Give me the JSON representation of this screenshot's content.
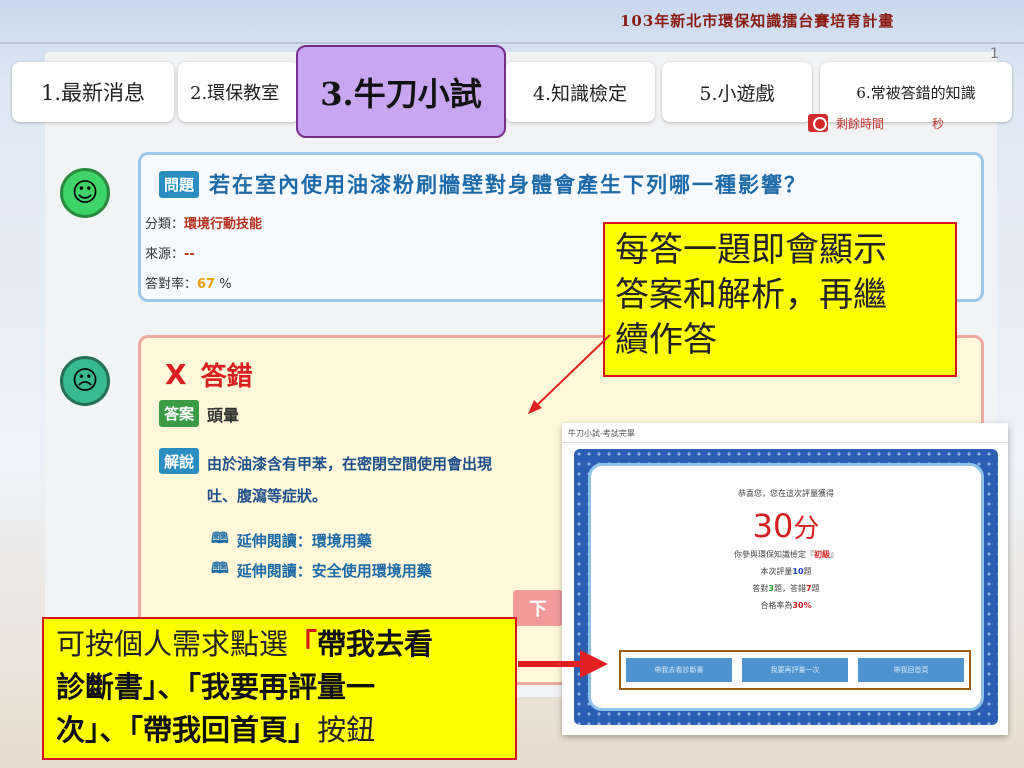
{
  "header": {
    "title": "103年新北市環保知識擂台賽培育計畫"
  },
  "page": {
    "number": "1"
  },
  "tabs": [
    {
      "label": "1.最新消息"
    },
    {
      "label": "2.環保教室"
    },
    {
      "label": "3.牛刀小試"
    },
    {
      "label": "4.知識檢定"
    },
    {
      "label": "5.小遊戲"
    },
    {
      "label": "6.常被答錯的知識"
    }
  ],
  "timer": {
    "label": "剩餘時間",
    "unit": "秒"
  },
  "question": {
    "badge": "問題",
    "text": "若在室內使用油漆粉刷牆壁對身體會產生下列哪一種影響？",
    "category_label": "分類：",
    "category_value": "環境行動技能",
    "source_label": "來源：",
    "source_value": "--",
    "rate_label": "答對率：",
    "rate_value": "67",
    "rate_unit": "%"
  },
  "answer": {
    "result_icon": "X",
    "result_text": "答錯",
    "answer_badge": "答案",
    "answer_value": "頭暈",
    "explain_badge": "解說",
    "explain_text": "由於油漆含有甲苯，在密閉空間使用會出現",
    "explain_text2": "吐、腹瀉等症狀。",
    "read_more_1": "延伸閱讀：環境用藥",
    "read_more_2": "延伸閱讀：安全使用環境用藥",
    "next_label": "下"
  },
  "callout_top": {
    "line1": "每答一題即會顯示",
    "line2": "答案和解析，再繼",
    "line3": "續作答"
  },
  "callout_bottom": {
    "prefix": "可按個人需求點選",
    "q1": "「",
    "b1": "帶我去看",
    "b2": "診斷書",
    "q2": "」、「",
    "b3": "我要再評量一",
    "b4": "次",
    "q3": "」、「",
    "b5": "帶我回首頁",
    "q4": "」",
    "suffix": "按鈕"
  },
  "result_window": {
    "title": "牛刀小試-考試完畢",
    "congrats": "恭喜您，您在這次評量獲得",
    "score": "30",
    "score_unit": "分",
    "level_prefix": "你參與環保知識檢定『",
    "level_value": "初級",
    "level_suffix": "』",
    "count_prefix": "本次評量",
    "count_value": "10",
    "count_suffix": "題",
    "right_prefix": "答對",
    "right_value": "3",
    "right_mid": "題，答錯",
    "wrong_value": "7",
    "wrong_suffix": "題",
    "pass_prefix": "合格率為",
    "pass_value": "30",
    "pass_suffix": "%",
    "buttons": [
      "帶我去看診斷書",
      "我要再評量一次",
      "帶我回首頁"
    ]
  }
}
